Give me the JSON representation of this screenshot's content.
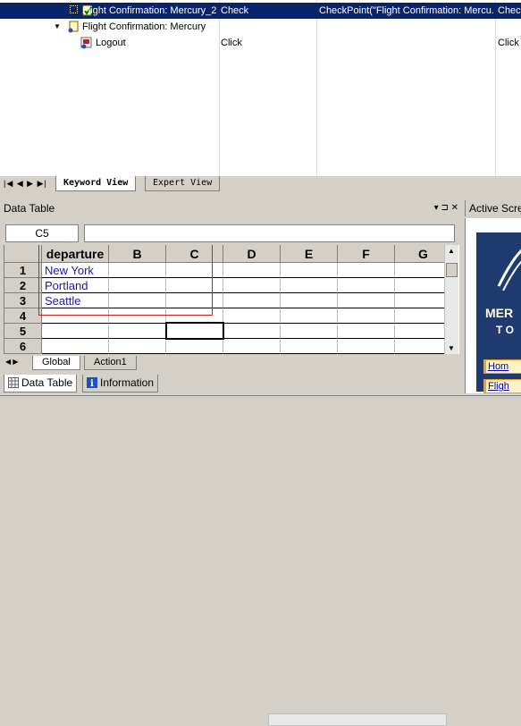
{
  "keyword_view": {
    "rows": [
      {
        "item": "Flight Confirmation: Mercury_2",
        "operation": "Check",
        "value": "CheckPoint(\"Flight Confirmation: Mercu...",
        "documentation": "Check",
        "selected": true,
        "indent": 92,
        "icon": "checkpoint-icon"
      },
      {
        "item": "Flight Confirmation: Mercury",
        "operation": "",
        "value": "",
        "documentation": "",
        "selected": false,
        "indent": 92,
        "icon": "page-icon"
      },
      {
        "item": "Logout",
        "operation": "Click",
        "value": "",
        "documentation": "Click t",
        "selected": false,
        "indent": 107,
        "icon": "image-icon"
      }
    ],
    "tabs": {
      "keyword": "Keyword View",
      "expert": "Expert View"
    }
  },
  "data_table": {
    "title": "Data Table",
    "panel_controls": "▾ ⊐ ✕",
    "cell_ref": "C5",
    "formula": "",
    "columns": [
      "departure",
      "B",
      "C",
      "D",
      "E",
      "F",
      "G"
    ],
    "row_numbers": [
      "1",
      "2",
      "3",
      "4",
      "5",
      "6"
    ],
    "cells": [
      [
        "New York",
        "",
        "",
        "",
        "",
        "",
        ""
      ],
      [
        "Portland",
        "",
        "",
        "",
        "",
        "",
        ""
      ],
      [
        "Seattle",
        "",
        "",
        "",
        "",
        "",
        ""
      ],
      [
        "",
        "",
        "",
        "",
        "",
        "",
        ""
      ],
      [
        "",
        "",
        "",
        "",
        "",
        "",
        ""
      ],
      [
        "",
        "",
        "",
        "",
        "",
        "",
        ""
      ]
    ],
    "sheet_tabs": [
      "Global",
      "Action1"
    ]
  },
  "bottom_tabs": {
    "data_table": "Data Table",
    "information": "Information"
  },
  "active_screen": {
    "title": "Active Scre",
    "logo_line1": "MER",
    "logo_line2": "T O",
    "links": [
      "Hom",
      "Fligh"
    ]
  }
}
